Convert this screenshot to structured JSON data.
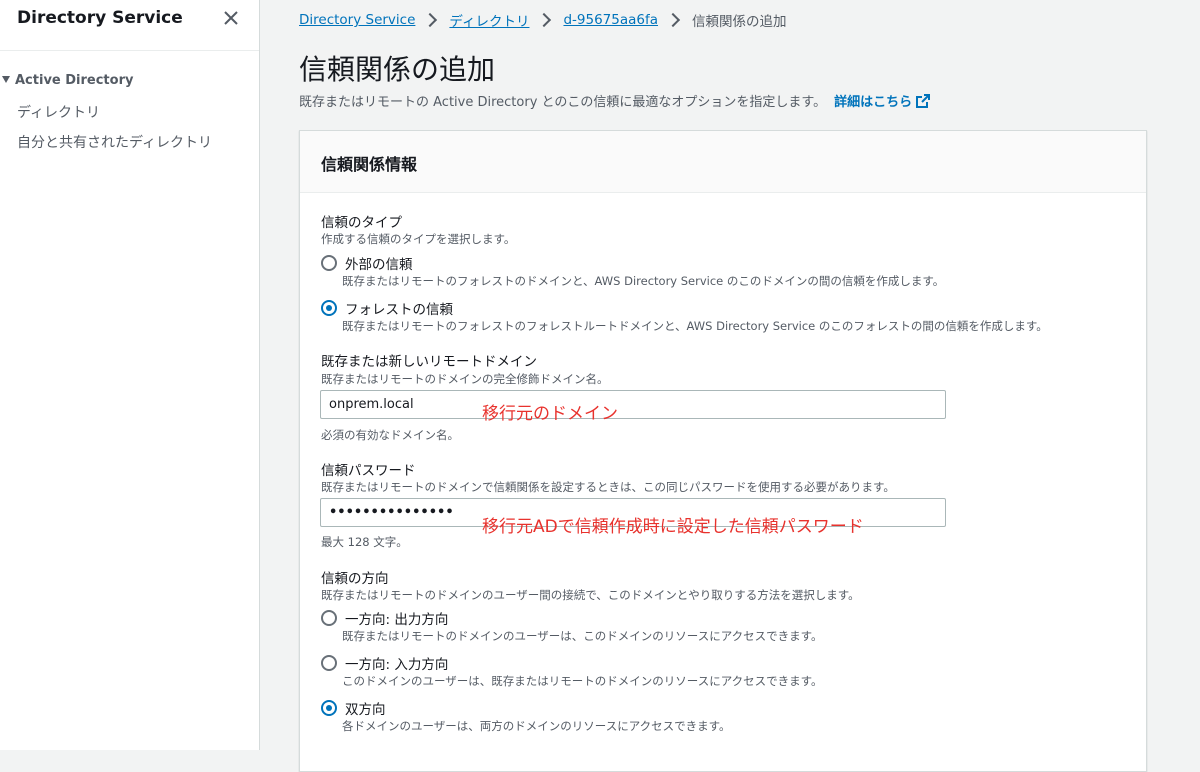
{
  "sidebar": {
    "title": "Directory Service",
    "section": "Active Directory",
    "items": [
      {
        "label": "ディレクトリ"
      },
      {
        "label": "自分と共有されたディレクトリ"
      }
    ]
  },
  "breadcrumb": {
    "items": [
      "Directory Service",
      "ディレクトリ",
      "d-95675aa6fa"
    ],
    "current": "信頼関係の追加"
  },
  "page": {
    "title": "信頼関係の追加",
    "description": "既存またはリモートの Active Directory とのこの信頼に最適なオプションを指定します。",
    "learn_more": "詳細はこちら"
  },
  "panel": {
    "title": "信頼関係情報",
    "trust_type": {
      "label": "信頼のタイプ",
      "description": "作成する信頼のタイプを選択します。",
      "options": [
        {
          "label": "外部の信頼",
          "description": "既存またはリモートのフォレストのドメインと、AWS Directory Service のこのドメインの間の信頼を作成します。",
          "selected": false
        },
        {
          "label": "フォレストの信頼",
          "description": "既存またはリモートのフォレストのフォレストルートドメインと、AWS Directory Service のこのフォレストの間の信頼を作成します。",
          "selected": true
        }
      ]
    },
    "remote_domain": {
      "label": "既存または新しいリモートドメイン",
      "description": "既存またはリモートのドメインの完全修飾ドメイン名。",
      "value": "onprem.local",
      "hint": "必須の有効なドメイン名。",
      "annotation": "移行元のドメイン"
    },
    "trust_password": {
      "label": "信頼パスワード",
      "description": "既存またはリモートのドメインで信頼関係を設定するときは、この同じパスワードを使用する必要があります。",
      "value": "•••••••••••••••",
      "hint": "最大 128 文字。",
      "annotation": "移行元ADで信頼作成時に設定した信頼パスワード"
    },
    "direction": {
      "label": "信頼の方向",
      "description": "既存またはリモートのドメインのユーザー間の接続で、このドメインとやり取りする方法を選択します。",
      "options": [
        {
          "label": "一方向: 出力方向",
          "description": "既存またはリモートのドメインのユーザーは、このドメインのリソースにアクセスできます。",
          "selected": false
        },
        {
          "label": "一方向: 入力方向",
          "description": "このドメインのユーザーは、既存またはリモートのドメインのリソースにアクセスできます。",
          "selected": false
        },
        {
          "label": "双方向",
          "description": "各ドメインのユーザーは、両方のドメインのリソースにアクセスできます。",
          "selected": true
        }
      ]
    }
  },
  "icons": {
    "close": "close-icon",
    "external": "external-link-icon",
    "chevron": "chevron-right-icon",
    "collapse": "caret-down-icon"
  },
  "colors": {
    "link": "#0073bb",
    "annotation": "#e8322d",
    "radio_selected": "#0073bb"
  }
}
